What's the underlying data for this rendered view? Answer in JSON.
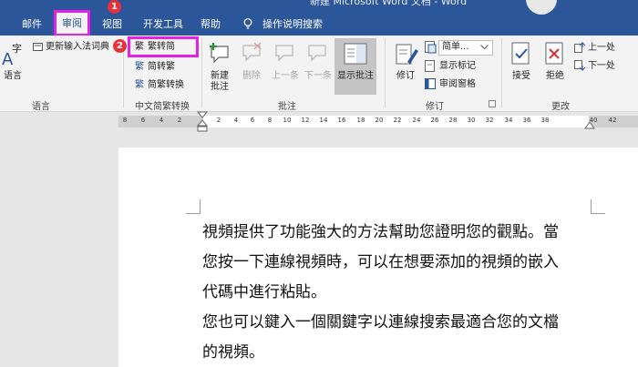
{
  "window": {
    "title": "新建 Microsoft Word 文档 - Word"
  },
  "tabs": [
    {
      "label": "邮件"
    },
    {
      "label": "审阅",
      "active": true
    },
    {
      "label": "视图"
    },
    {
      "label": "开发工具"
    },
    {
      "label": "帮助"
    },
    {
      "label": "操作说明搜索"
    }
  ],
  "badges": {
    "one": "1",
    "two": "2"
  },
  "ribbon": {
    "language": {
      "update_ime": "更新输入法词典",
      "language_btn": "语言",
      "language_icon_text": "字",
      "group_label": "语言"
    },
    "chinese": {
      "to_simplified": "繁转简",
      "to_traditional": "简转繁",
      "conversion": "简繁转换",
      "group_label": "中文简繁转换"
    },
    "comments": {
      "new_line1": "新建",
      "new_line2": "批注",
      "delete": "删除",
      "previous": "上一条",
      "next": "下一条",
      "show": "显示批注",
      "group_label": "批注"
    },
    "tracking": {
      "track": "修订",
      "simple_markup": "简单...",
      "show_markup": "显示标记",
      "reviewing_pane": "审阅窗格",
      "group_label": "修订"
    },
    "changes": {
      "accept": "接受",
      "reject": "拒绝",
      "previous": "上一处",
      "next": "下一处",
      "group_label": "更改"
    }
  },
  "ruler": {
    "ticks": [
      "8",
      "6",
      "4",
      "2",
      "2",
      "4",
      "6",
      "8",
      "10",
      "12",
      "14",
      "16",
      "18",
      "20",
      "22",
      "24",
      "26",
      "28",
      "30",
      "32",
      "34",
      "36",
      "38",
      "40",
      "42"
    ]
  },
  "document": {
    "lines": [
      "視頻提供了功能強大的方法幫助您證明您的觀點。當",
      "您按一下連線視頻時，可以在想要添加的視頻的嵌入",
      "代碼中進行粘貼。",
      "您也可以鍵入一個關鍵字以連線搜索最適合您的文檔",
      "的視頻。"
    ]
  },
  "colors": {
    "brand": "#2b579a",
    "highlight": "#e521e5",
    "badge": "#e8313b"
  }
}
